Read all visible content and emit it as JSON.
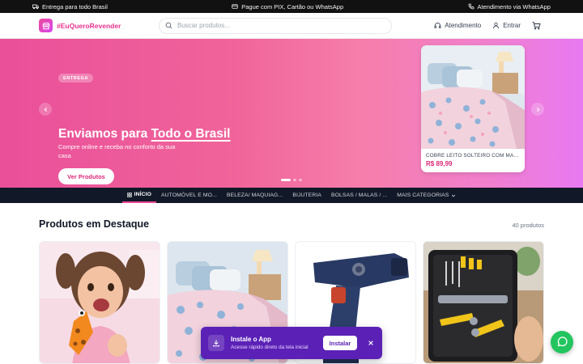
{
  "topbar": {
    "shipping": "Entrega para todo Brasil",
    "payment": "Pague com PIX, Cartão ou WhatsApp",
    "support": "Atendimento via WhatsApp"
  },
  "header": {
    "logo_text": "#EuQueroRevender",
    "search_placeholder": "Buscar produtos...",
    "support_label": "Atendimento",
    "login_label": "Entrar"
  },
  "hero": {
    "badge": "ENTREGA",
    "title_prefix": "Enviamos para ",
    "title_highlight": "Todo o Brasil",
    "subtitle": "Compre online e receba no conforto da sua casa",
    "cta_label": "Ver Produtos",
    "card": {
      "name": "COBRE LEITO SOLTEIRO COM MANTA...",
      "price": "R$ 89,99"
    },
    "slide_count": 3,
    "active_slide": 1
  },
  "categories": [
    {
      "label": "INÍCIO",
      "active": true
    },
    {
      "label": "AUTOMÓVEL E MO...",
      "active": false
    },
    {
      "label": "BELEZA/ MAQUIAG...",
      "active": false
    },
    {
      "label": "BIJUTERIA",
      "active": false
    },
    {
      "label": "BOLSAS / MALAS / ...",
      "active": false
    },
    {
      "label": "MAIS CATEGORIAS",
      "active": false
    }
  ],
  "featured": {
    "title": "Produtos em Destaque",
    "count": "40 produtos"
  },
  "install": {
    "title": "Instale o App",
    "subtitle": "Acesse rápido direto da tela inicial",
    "button": "Instalar"
  },
  "colors": {
    "accent": "#ec4899",
    "brand_text": "#e6318d",
    "nav_bg": "#111827",
    "popup_bg": "#5b21b6",
    "whatsapp": "#22c55e"
  }
}
